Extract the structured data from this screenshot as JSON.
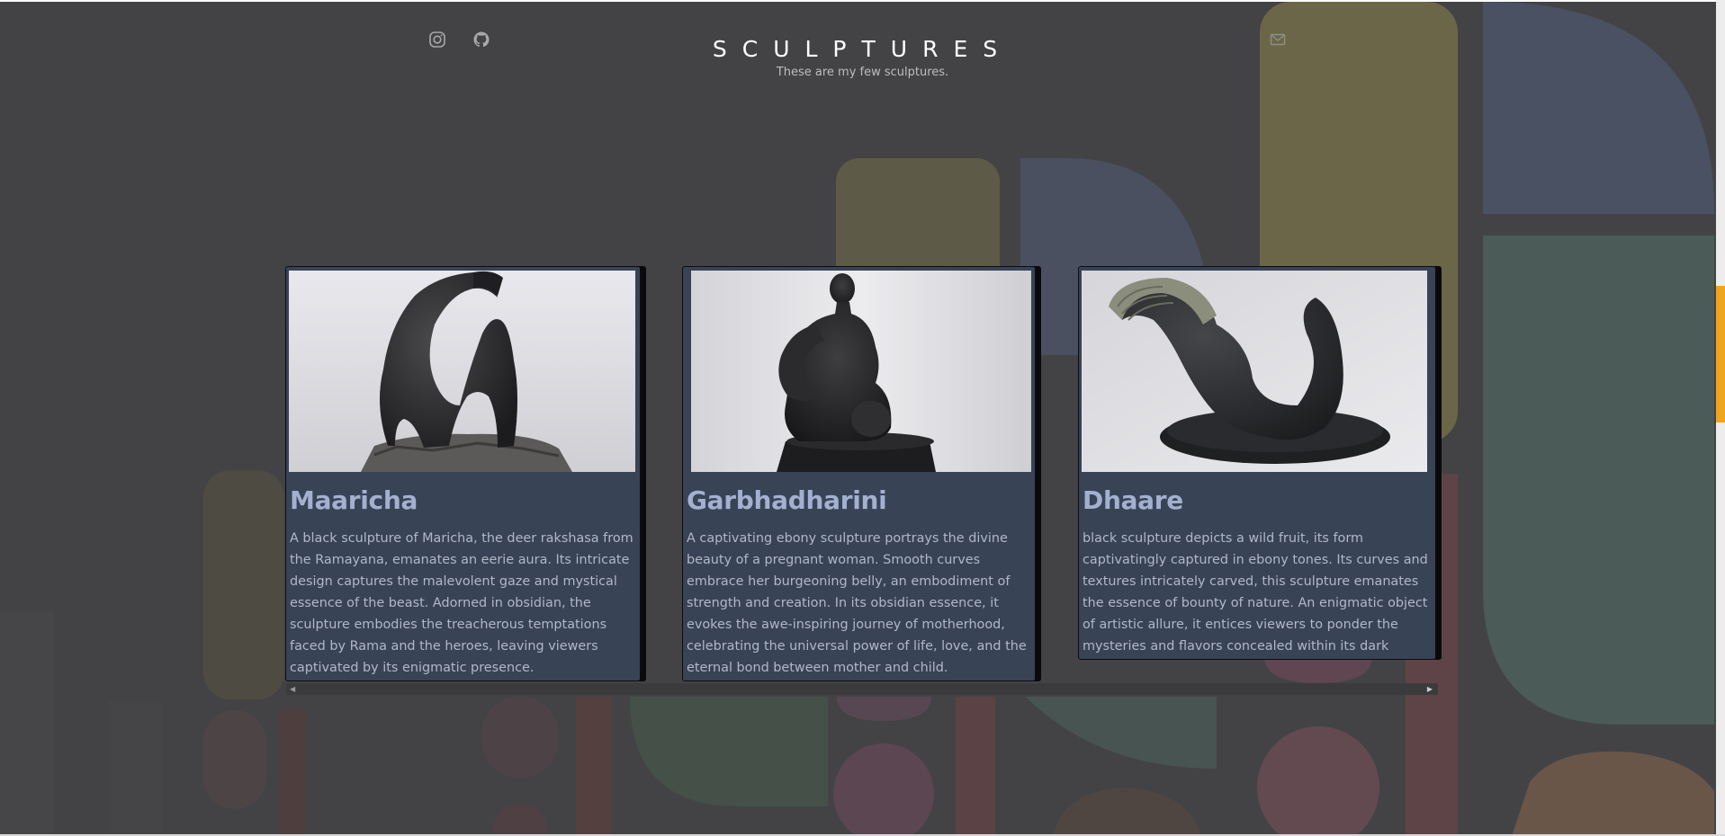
{
  "header": {
    "title": "SCULPTURES",
    "subtitle": "These are my few sculptures.",
    "icons": {
      "instagram": "instagram-icon",
      "github": "github-icon",
      "email": "mail-icon"
    }
  },
  "cards": [
    {
      "title": "Maaricha",
      "description": "A black sculpture of Maricha, the deer rakshasa from the Ramayana, emanates an eerie aura. Its intricate design captures the malevolent gaze and mystical essence of the beast. Adorned in obsidian, the sculpture embodies the treacherous temptations faced by Rama and the heroes, leaving viewers captivated by its enigmatic presence."
    },
    {
      "title": "Garbhadharini",
      "description": "A captivating ebony sculpture portrays the divine beauty of a pregnant woman. Smooth curves embrace her burgeoning belly, an embodiment of strength and creation. In its obsidian essence, it evokes the awe-inspiring journey of motherhood, celebrating the universal power of life, love, and the eternal bond between mother and child."
    },
    {
      "title": "Dhaare",
      "description": "black sculpture depicts a wild fruit, its form captivatingly captured in ebony tones. Its curves and textures intricately carved, this sculpture emanates the essence of bounty of nature. An enigmatic object of artistic allure, it entices viewers to ponder the mysteries and flavors concealed within its dark allure."
    }
  ],
  "colors": {
    "page_background": "#434346",
    "card_background": "#384356",
    "card_title": "#a3b0cf",
    "card_text": "#b1b8c6",
    "scrollbar_thumb": "#f1a51d"
  }
}
